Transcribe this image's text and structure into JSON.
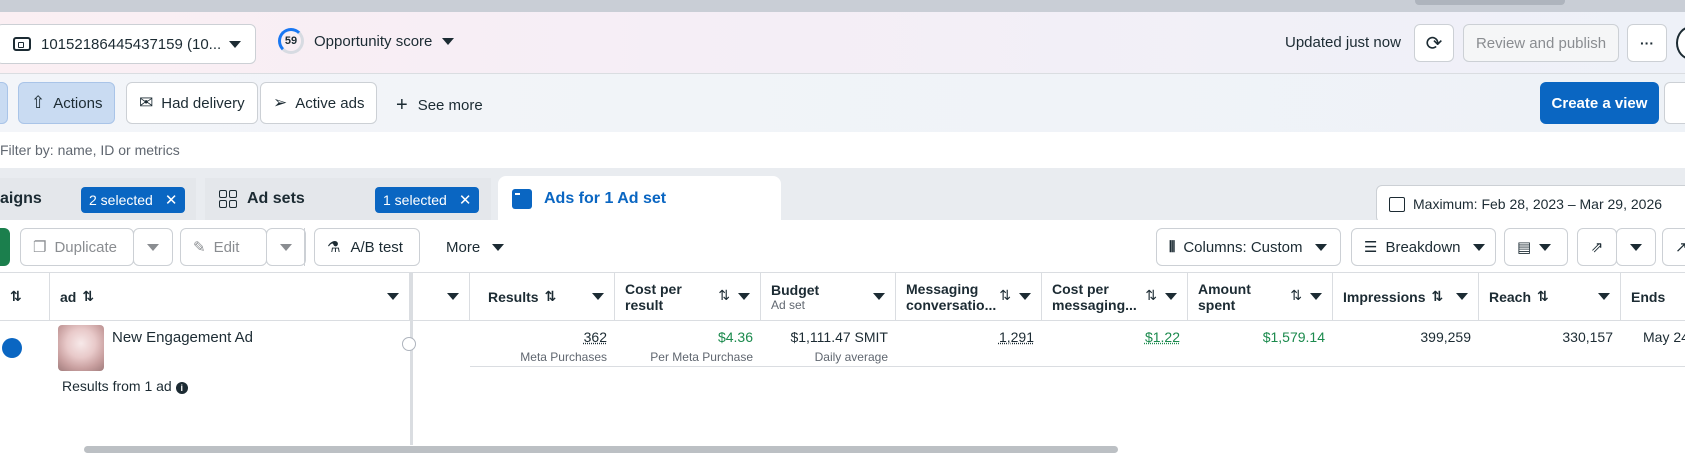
{
  "header": {
    "account_id": "10152186445437159 (10...",
    "score_value": "59",
    "score_label": "Opportunity score",
    "updated": "Updated just now",
    "review_publish": "Review and publish",
    "more": "···"
  },
  "filters": {
    "actions": "Actions",
    "had_delivery": "Had delivery",
    "active_ads": "Active ads",
    "see_more": "See more",
    "create_view": "Create a view",
    "search_placeholder": "Filter by: name, ID or metrics"
  },
  "tabs": {
    "campaigns": "aigns",
    "campaigns_chip": "2 selected",
    "adsets": "Ad sets",
    "adsets_chip": "1 selected",
    "ads": "Ads for 1 Ad set",
    "date_range": "Maximum: Feb 28, 2023 – Mar 29, 2026"
  },
  "toolbar": {
    "duplicate": "Duplicate",
    "edit": "Edit",
    "ab_test": "A/B test",
    "more": "More",
    "columns": "Columns: Custom",
    "breakdown": "Breakdown"
  },
  "table": {
    "headers": {
      "ad": "ad",
      "results": "Results",
      "cost_per_result": [
        "Cost per",
        "result"
      ],
      "budget": "Budget",
      "budget_sub": "Ad set",
      "messaging": [
        "Messaging",
        "conversatio..."
      ],
      "cost_per_messaging": [
        "Cost per",
        "messaging..."
      ],
      "amount_spent": [
        "Amount",
        "spent"
      ],
      "impressions": "Impressions",
      "reach": "Reach",
      "ends": "Ends"
    },
    "row": {
      "ad_name": "New Engagement Ad",
      "results": "362",
      "results_sub": "Meta Purchases",
      "cost_per_result": "$4.36",
      "cost_per_result_sub": "Per Meta Purchase",
      "budget": "$1,111.47 SMIT",
      "budget_sub": "Daily average",
      "messaging": "1,291",
      "cost_per_messaging": "$1.22",
      "amount_spent": "$1,579.14",
      "impressions": "399,259",
      "reach": "330,157",
      "ends": "May 24"
    },
    "summary": "Results from 1 ad",
    "sort_glyph": "⇅"
  }
}
